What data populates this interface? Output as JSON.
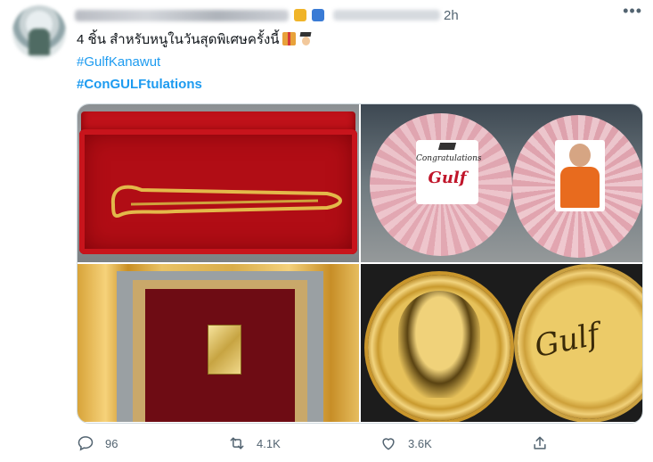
{
  "tweet": {
    "time": "2h",
    "more_label": "•••",
    "text_line1": "4 ชิ้น สำหรับหนูในวันสุดพิเศษครั้งนี้",
    "hashtag1": "#GulfKanawut",
    "hashtag2": "#ConGULFtulations"
  },
  "images": {
    "tile2_card_text": "Congratulations",
    "tile2_card_name": "Gulf",
    "tile4_signature": "Gulf"
  },
  "actions": {
    "replies": "96",
    "retweets": "4.1K",
    "likes": "3.6K"
  },
  "icons": {
    "reply": "reply-icon",
    "retweet": "retweet-icon",
    "like": "heart-icon",
    "share": "share-icon",
    "more": "more-icon"
  },
  "colors": {
    "link": "#1d9bf0",
    "muted": "#536471"
  }
}
